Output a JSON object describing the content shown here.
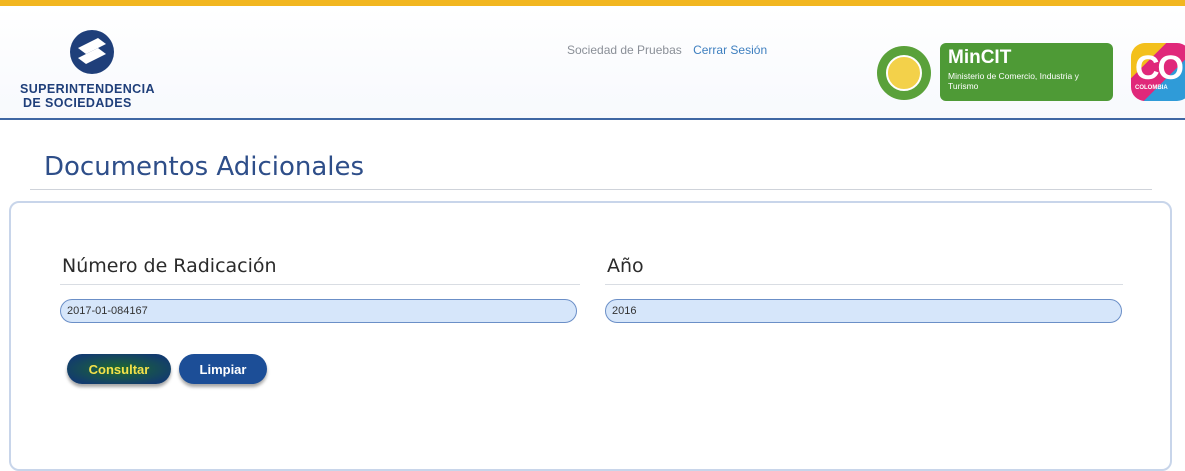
{
  "header": {
    "brand_line1": "SUPERINTENDENCIA",
    "brand_line2": "DE SOCIEDADES",
    "user_name": "Sociedad de Pruebas",
    "logout_label": "Cerrar Sesión",
    "ministry_title": "MinCIT",
    "ministry_subtitle": "Ministerio de Comercio, Industria y Turismo",
    "country_logo_text": "CO",
    "country_logo_small": "COLOMBIA"
  },
  "page": {
    "title": "Documentos Adicionales"
  },
  "form": {
    "radicacion_label": "Número de Radicación",
    "radicacion_value": "2017-01-084167",
    "anio_label": "Año",
    "anio_value": "2016",
    "consultar_label": "Consultar",
    "limpiar_label": "Limpiar"
  },
  "colors": {
    "accent_stripe": "#f2b620",
    "title_blue": "#2e4e89",
    "ministry_green": "#4e9a36",
    "input_fill": "#d6e6fa"
  }
}
